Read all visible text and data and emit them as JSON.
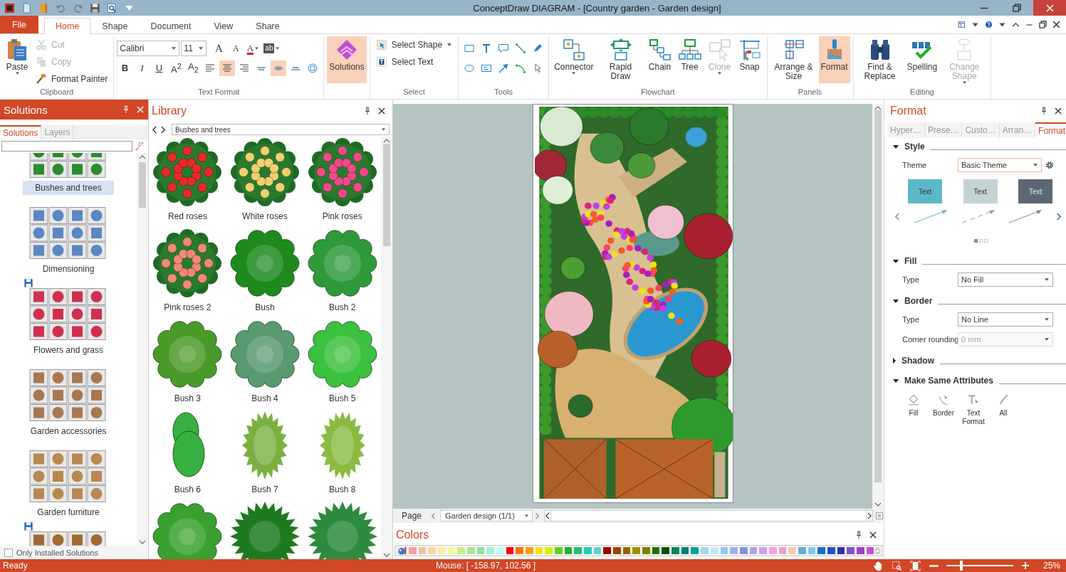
{
  "window": {
    "title": "ConceptDraw DIAGRAM - [Country garden - Garden design]"
  },
  "quick_access": [
    {
      "kind": "app",
      "disabled": false
    },
    {
      "kind": "new",
      "disabled": false
    },
    {
      "kind": "open",
      "disabled": false
    },
    {
      "kind": "undo",
      "disabled": true
    },
    {
      "kind": "redo",
      "disabled": true
    },
    {
      "kind": "save",
      "disabled": false
    },
    {
      "kind": "preview",
      "disabled": false
    },
    {
      "kind": "customize",
      "disabled": false
    }
  ],
  "ribbon_tabs": [
    {
      "label": "File",
      "kind": "file",
      "selected": false
    },
    {
      "label": "Home",
      "kind": "tab",
      "selected": true
    },
    {
      "label": "Shape",
      "kind": "tab",
      "selected": false
    },
    {
      "label": "Document",
      "kind": "tab",
      "selected": false
    },
    {
      "label": "View",
      "kind": "tab",
      "selected": false
    },
    {
      "label": "Share",
      "kind": "tab",
      "selected": false
    }
  ],
  "ribbon_groups": [
    {
      "label": "Clipboard",
      "items": [
        {
          "kind": "paste",
          "label": "Paste",
          "dropdown": true,
          "selected": false,
          "disabled": false
        },
        {
          "kind": "stack",
          "items": [
            {
              "kind": "cut",
              "label": "Cut",
              "disabled": true
            },
            {
              "kind": "copy",
              "label": "Copy",
              "disabled": true
            },
            {
              "kind": "painter",
              "label": "Format Painter",
              "disabled": false
            }
          ]
        }
      ]
    },
    {
      "label": "Text Format",
      "items": [
        {
          "kind": "rows",
          "lines": [
            {
              "tools": [
                {
                  "kind": "font-combo",
                  "value": "Calibri"
                },
                {
                  "kind": "size-combo",
                  "value": "11"
                },
                {
                  "kind": "grow",
                  "text": "A",
                  "selected": false
                },
                {
                  "kind": "shrink",
                  "text": "A",
                  "selected": false
                },
                {
                  "kind": "fontcolor",
                  "text": "A",
                  "selected": false,
                  "dropdown": true
                },
                {
                  "kind": "highlight",
                  "text": "ab",
                  "selected": false,
                  "dropdown": true
                }
              ]
            },
            {
              "tools": [
                {
                  "kind": "bold",
                  "text": "B",
                  "selected": false
                },
                {
                  "kind": "italic",
                  "text": "I",
                  "selected": false
                },
                {
                  "kind": "underline",
                  "text": "U",
                  "selected": false
                },
                {
                  "kind": "superscript",
                  "text": "A$^{2}$",
                  "selected": false
                },
                {
                  "kind": "subscript",
                  "text": "A$_{2}$",
                  "selected": false
                },
                {
                  "kind": "align-left",
                  "selected": false
                },
                {
                  "kind": "align-center",
                  "selected": true
                },
                {
                  "kind": "align-right",
                  "selected": false
                },
                {
                  "kind": "valign-top",
                  "selected": false
                },
                {
                  "kind": "valign-middle",
                  "selected": true
                },
                {
                  "kind": "valign-bottom",
                  "selected": false
                },
                {
                  "kind": "fit",
                  "selected": false
                }
              ]
            }
          ]
        }
      ]
    },
    {
      "items": [
        {
          "kind": "solutions",
          "label": "Solutions",
          "selected": true,
          "disabled": false
        }
      ]
    },
    {
      "label": "Select",
      "items": [
        {
          "kind": "stack",
          "items": [
            {
              "kind": "select-shape",
              "label": "Select Shape",
              "disabled": false,
              "dropdown": true
            },
            {
              "kind": "select-text",
              "label": "Select Text",
              "disabled": false
            }
          ]
        }
      ]
    },
    {
      "label": "Tools",
      "items": [
        {
          "kind": "rows",
          "lines": [
            {
              "tools": [
                {
                  "kind": "rect",
                  "selected": false
                },
                {
                  "kind": "text-block",
                  "selected": false
                },
                {
                  "kind": "callout",
                  "selected": false
                },
                {
                  "kind": "line",
                  "selected": false
                },
                {
                  "kind": "pen",
                  "selected": false
                }
              ]
            },
            {
              "tools": [
                {
                  "kind": "ellipse",
                  "selected": false
                },
                {
                  "kind": "textbox",
                  "selected": false
                },
                {
                  "kind": "arrow",
                  "selected": false
                },
                {
                  "kind": "curve",
                  "selected": false
                },
                {
                  "kind": "pointer",
                  "selected": false
                }
              ]
            }
          ]
        }
      ]
    },
    {
      "label": "Flowchart",
      "items": [
        {
          "kind": "connector",
          "label": "Connector",
          "dropdown": true,
          "selected": false,
          "disabled": false
        },
        {
          "kind": "rapid-draw",
          "label": "Rapid Draw",
          "selected": false,
          "disabled": false
        },
        {
          "kind": "chain",
          "label": "Chain",
          "selected": false,
          "disabled": false
        },
        {
          "kind": "tree",
          "label": "Tree",
          "selected": false,
          "disabled": false
        },
        {
          "kind": "clone",
          "label": "Clone",
          "dropdown": true,
          "selected": false,
          "disabled": true
        },
        {
          "kind": "snap",
          "label": "Snap",
          "selected": false,
          "disabled": false
        }
      ]
    },
    {
      "label": "Panels",
      "items": [
        {
          "kind": "arrange",
          "label": "Arrange & Size",
          "selected": false,
          "disabled": false
        },
        {
          "kind": "brush",
          "label": "Format",
          "selected": true,
          "disabled": false
        }
      ]
    },
    {
      "label": "Editing",
      "items": [
        {
          "kind": "binoculars",
          "label": "Find & Replace",
          "selected": false,
          "disabled": false
        },
        {
          "kind": "spelling",
          "label": "Spelling",
          "selected": false,
          "disabled": false
        },
        {
          "kind": "change-shape",
          "label": "Change Shape",
          "dropdown": true,
          "selected": false,
          "disabled": true
        }
      ]
    }
  ],
  "solutions_panel": {
    "title": "Solutions",
    "tabs": [
      {
        "label": "Solutions",
        "selected": true
      },
      {
        "label": "Layers",
        "selected": false
      }
    ],
    "categories": [
      {
        "label": "Bushes and trees",
        "selected": true,
        "saved": false,
        "color": "#2e8b2e"
      },
      {
        "label": "Dimensioning",
        "selected": false,
        "saved": false,
        "color": "#5a88c0"
      },
      {
        "label": "Flowers and grass",
        "selected": false,
        "saved": true,
        "color": "#d03050"
      },
      {
        "label": "Garden accessories",
        "selected": false,
        "saved": false,
        "color": "#a87850"
      },
      {
        "label": "Garden furniture",
        "selected": false,
        "saved": false,
        "color": "#b88850"
      },
      {
        "selected": false,
        "saved": true,
        "color": "#a06a30"
      }
    ],
    "only_installed": {
      "label": "Only Installed Solutions",
      "checked": false
    }
  },
  "library": {
    "title": "Library",
    "dropdown": "Bushes and trees",
    "items": [
      {
        "label": "Red roses",
        "kind": "roses",
        "color": "#e82a2a"
      },
      {
        "label": "White roses",
        "kind": "roses",
        "color": "#f0d070"
      },
      {
        "label": "Pink roses",
        "kind": "roses",
        "color": "#f04a8a"
      },
      {
        "label": "Pink roses 2",
        "kind": "roses",
        "color": "#f08a72"
      },
      {
        "label": "Bush",
        "kind": "bush",
        "color": "#1e8a1e"
      },
      {
        "label": "Bush 2",
        "kind": "bush",
        "color": "#2e9a3a"
      },
      {
        "label": "Bush 3",
        "kind": "bush",
        "color": "#4a9a2a"
      },
      {
        "label": "Bush 4",
        "kind": "bush",
        "color": "#5a9a70"
      },
      {
        "label": "Bush 5",
        "kind": "bush",
        "color": "#3cc040"
      },
      {
        "label": "Bush 6",
        "kind": "tall",
        "color": "#36b040"
      },
      {
        "label": "Bush 7",
        "kind": "spiky-oval",
        "color": "#7ab040"
      },
      {
        "label": "Bush 8",
        "kind": "spiky-oval",
        "color": "#8aba40"
      },
      {
        "kind": "bush",
        "color": "#3aa030"
      },
      {
        "kind": "spiky",
        "color": "#1e7a1e"
      },
      {
        "kind": "spiky",
        "color": "#2e8a3e"
      }
    ]
  },
  "canvas": {
    "page_nav": {
      "label": "Page",
      "dropdown": "Garden design (1/1)"
    }
  },
  "colors": {
    "title": "Colors",
    "swatches": [
      {
        "color": "#f4a0a0"
      },
      {
        "color": "#f8c0a0"
      },
      {
        "color": "#fcd8a0"
      },
      {
        "color": "#fcf0a0"
      },
      {
        "color": "#f0f8a0"
      },
      {
        "color": "#c8f080"
      },
      {
        "color": "#a8e890"
      },
      {
        "color": "#90e0a0"
      },
      {
        "color": "#a0f0d8"
      },
      {
        "color": "#c0f8f8"
      },
      {
        "color": "#ff0000"
      },
      {
        "color": "#ff7000"
      },
      {
        "color": "#ffa000"
      },
      {
        "color": "#ffe000"
      },
      {
        "color": "#d8f000"
      },
      {
        "color": "#60d020"
      },
      {
        "color": "#20b030"
      },
      {
        "color": "#20c070"
      },
      {
        "color": "#20d0b0"
      },
      {
        "color": "#60d0d0"
      },
      {
        "color": "#a00000"
      },
      {
        "color": "#a04000"
      },
      {
        "color": "#a06000"
      },
      {
        "color": "#a09000"
      },
      {
        "color": "#808000"
      },
      {
        "color": "#207000"
      },
      {
        "color": "#005000"
      },
      {
        "color": "#108050"
      },
      {
        "color": "#008070"
      },
      {
        "color": "#00a0a0"
      },
      {
        "color": "#a0d8f0"
      },
      {
        "color": "#c0e8f8"
      },
      {
        "color": "#90c8f8"
      },
      {
        "color": "#a0b0f0"
      },
      {
        "color": "#8090e8"
      },
      {
        "color": "#b0a0f0"
      },
      {
        "color": "#d0a0f0"
      },
      {
        "color": "#f0a0e8"
      },
      {
        "color": "#f0a0c0"
      },
      {
        "color": "#f8c8b8"
      },
      {
        "color": "#60b0d0"
      },
      {
        "color": "#80c8f0"
      },
      {
        "color": "#1070d0"
      },
      {
        "color": "#2050d0"
      },
      {
        "color": "#3030b0"
      },
      {
        "color": "#8050d0"
      },
      {
        "color": "#a040c0"
      },
      {
        "color": "#c050d0"
      }
    ]
  },
  "format_panel": {
    "title": "Format",
    "tabs": [
      {
        "label": "Hyper…",
        "selected": false
      },
      {
        "label": "Prese…",
        "selected": false
      },
      {
        "label": "Custo…",
        "selected": false
      },
      {
        "label": "Arran…",
        "selected": false
      },
      {
        "label": "Format",
        "selected": true
      }
    ],
    "sections": [
      {
        "title": "Style",
        "expanded": true,
        "kind": "style",
        "theme_label": "Theme",
        "theme_value": "Basic Theme",
        "styles": [
          {
            "text": "Text",
            "color": "#5bb8c9"
          },
          {
            "text": "Text",
            "color": "#c5d3d6"
          },
          {
            "text": "Text",
            "color": "#5b6873"
          }
        ]
      },
      {
        "title": "Fill",
        "expanded": true,
        "kind": "fields",
        "fields": [
          {
            "label": "Type",
            "value": "No Fill",
            "disabled": false
          }
        ]
      },
      {
        "title": "Border",
        "expanded": true,
        "kind": "fields",
        "fields": [
          {
            "label": "Type",
            "value": "No Line",
            "disabled": false
          },
          {
            "label": "Corner rounding",
            "value": "0 mm",
            "disabled": true
          }
        ]
      },
      {
        "title": "Shadow",
        "expanded": false
      },
      {
        "title": "Make Same Attributes",
        "expanded": true,
        "kind": "buttons",
        "buttons": [
          {
            "label": "Fill",
            "kind": "fill"
          },
          {
            "label": "Border",
            "kind": "border"
          },
          {
            "label": "Text Format",
            "kind": "text-format"
          },
          {
            "label": "All",
            "kind": "all"
          }
        ]
      }
    ]
  },
  "status_bar": {
    "text": "Ready",
    "mouse": "Mouse: [ -158.97, 102.56 ]",
    "zoom": {
      "level": 0.2,
      "reading": "25%"
    }
  }
}
